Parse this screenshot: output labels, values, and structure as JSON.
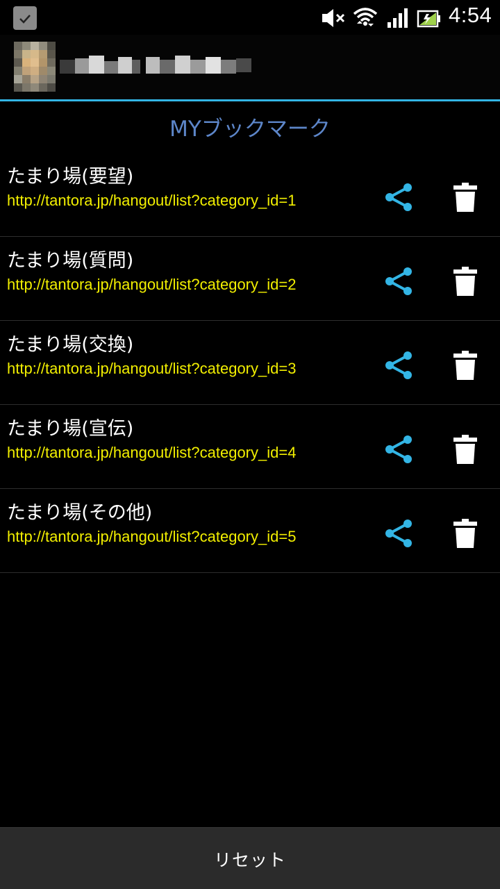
{
  "status_bar": {
    "time": "4:54",
    "icons": [
      "check-notification-icon",
      "mute-icon",
      "wifi-icon",
      "signal-icon",
      "battery-icon"
    ]
  },
  "title": "MYブックマーク",
  "bookmarks": [
    {
      "title": "たまり場(要望)",
      "url": "http://tantora.jp/hangout/list?category_id=1"
    },
    {
      "title": "たまり場(質問)",
      "url": "http://tantora.jp/hangout/list?category_id=2"
    },
    {
      "title": "たまり場(交換)",
      "url": "http://tantora.jp/hangout/list?category_id=3"
    },
    {
      "title": "たまり場(宣伝)",
      "url": "http://tantora.jp/hangout/list?category_id=4"
    },
    {
      "title": "たまり場(その他)",
      "url": "http://tantora.jp/hangout/list?category_id=5"
    }
  ],
  "reset_label": "リセット",
  "colors": {
    "accent": "#33b5e5",
    "title": "#5d86c9",
    "url": "#f2ef00",
    "share_icon": "#33b5e5",
    "delete_icon": "#ffffff"
  }
}
